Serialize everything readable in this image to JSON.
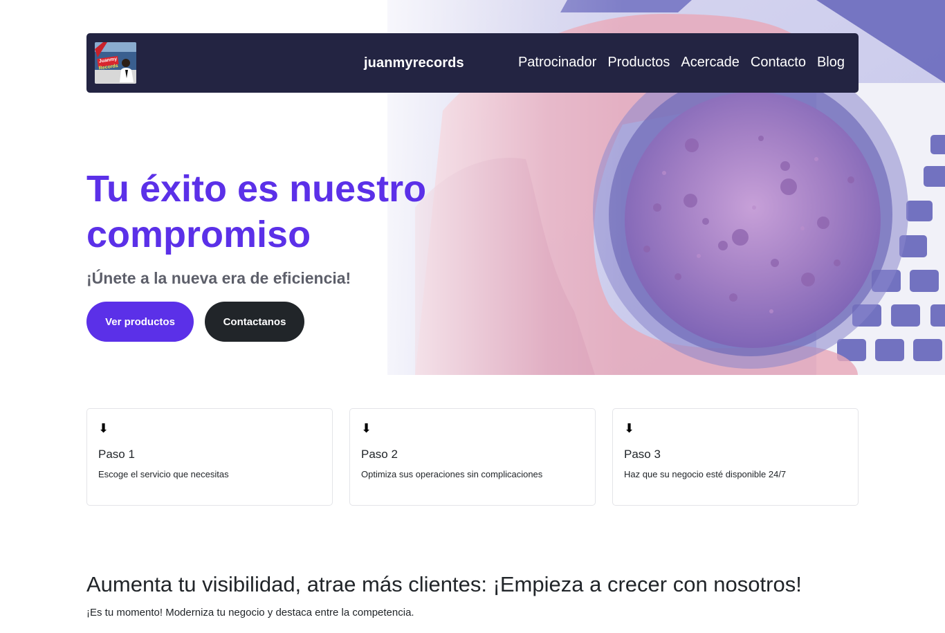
{
  "navbar": {
    "logo_text_line1": "Juanmy",
    "logo_text_line2": "Records",
    "brand": "juanmyrecords",
    "links": [
      "Patrocinador",
      "Productos",
      "Acercade",
      "Contacto",
      "Blog"
    ]
  },
  "hero": {
    "title": "Tu éxito es nuestro compromiso",
    "subtitle": "¡Únete a la nueva era de eficiencia!",
    "primary_button": "Ver productos",
    "secondary_button": "Contactanos",
    "background_image": "coffee-cup-on-keyboard-photo"
  },
  "steps": [
    {
      "icon": "⬇",
      "title": "Paso 1",
      "text": "Escoge el servicio que necesitas"
    },
    {
      "icon": "⬇",
      "title": "Paso 2",
      "text": "Optimiza sus operaciones sin complicaciones"
    },
    {
      "icon": "⬇",
      "title": "Paso 3",
      "text": "Haz que su negocio esté disponible 24/7"
    }
  ],
  "section": {
    "title": "Aumenta tu visibilidad, atrae más clientes: ¡Empieza a crecer con nosotros!",
    "text": "¡Es tu momento! Moderniza tu negocio y destaca entre la competencia."
  },
  "colors": {
    "accent": "#5b30e8",
    "navbar": "#232442",
    "dark_button": "#212529"
  }
}
